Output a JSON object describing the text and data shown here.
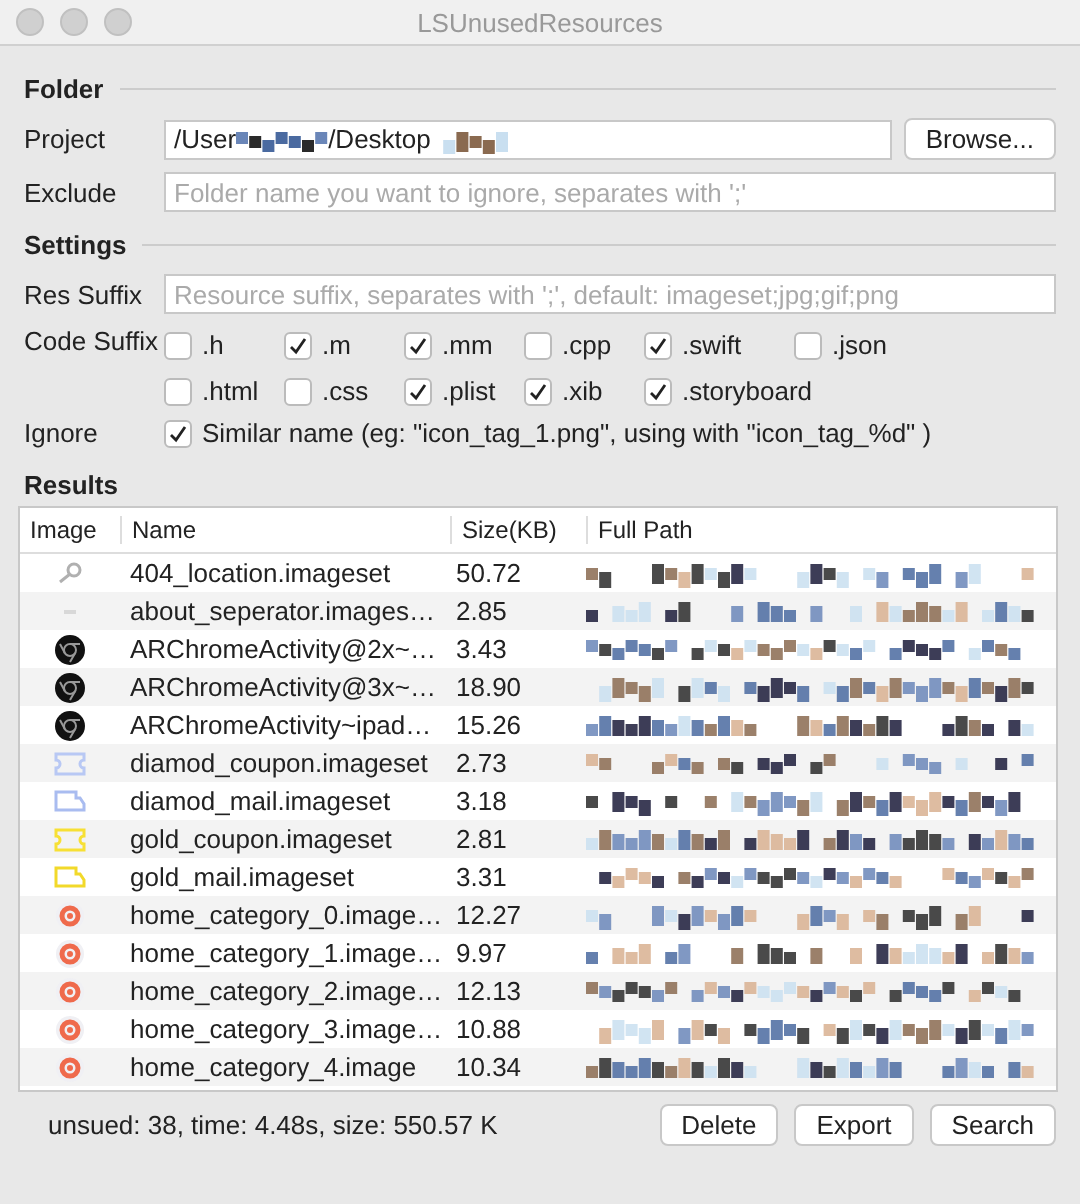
{
  "window": {
    "title": "LSUnusedResources"
  },
  "folder": {
    "heading": "Folder",
    "project_label": "Project",
    "project_parts": [
      "/User",
      "/Desktop"
    ],
    "browse_button": "Browse...",
    "exclude_label": "Exclude",
    "exclude_placeholder": "Folder name you want to ignore, separates with ';'"
  },
  "settings": {
    "heading": "Settings",
    "res_suffix_label": "Res Suffix",
    "res_suffix_placeholder": "Resource suffix, separates with ';', default: imageset;jpg;gif;png",
    "code_suffix_label": "Code Suffix",
    "suffixes": [
      [
        {
          "label": ".h",
          "checked": false
        },
        {
          "label": ".m",
          "checked": true
        },
        {
          "label": ".mm",
          "checked": true
        },
        {
          "label": ".cpp",
          "checked": false
        },
        {
          "label": ".swift",
          "checked": true
        },
        {
          "label": ".json",
          "checked": false
        }
      ],
      [
        {
          "label": ".html",
          "checked": false
        },
        {
          "label": ".css",
          "checked": false
        },
        {
          "label": ".plist",
          "checked": true
        },
        {
          "label": ".xib",
          "checked": true
        },
        {
          "label": ".storyboard",
          "checked": true
        }
      ]
    ],
    "ignore_label": "Ignore",
    "ignore_option": {
      "label": "Similar name (eg: \"icon_tag_1.png\", using with \"icon_tag_%d\" )",
      "checked": true
    }
  },
  "results": {
    "heading": "Results",
    "columns": [
      "Image",
      "Name",
      "Size(KB)",
      "Full Path"
    ],
    "rows": [
      {
        "kind": "pin",
        "color": "#b0b0b0",
        "name": "404_location.imageset",
        "size": "50.72"
      },
      {
        "kind": "line",
        "color": "#d8d8d8",
        "name": "about_seperator.images…",
        "size": "2.85"
      },
      {
        "kind": "chrome",
        "color": "#111111",
        "name": "ARChromeActivity@2x~…",
        "size": "3.43"
      },
      {
        "kind": "chrome",
        "color": "#111111",
        "name": "ARChromeActivity@3x~…",
        "size": "18.90"
      },
      {
        "kind": "chrome",
        "color": "#111111",
        "name": "ARChromeActivity~ipad…",
        "size": "15.26"
      },
      {
        "kind": "coupon",
        "color": "#b8c8f4",
        "name": "diamod_coupon.imageset",
        "size": "2.73"
      },
      {
        "kind": "mail",
        "color": "#a9bcf0",
        "name": "diamod_mail.imageset",
        "size": "3.18"
      },
      {
        "kind": "coupon",
        "color": "#f7e034",
        "name": "gold_coupon.imageset",
        "size": "2.81"
      },
      {
        "kind": "mail",
        "color": "#f2d92a",
        "name": "gold_mail.imageset",
        "size": "3.31"
      },
      {
        "kind": "category",
        "color": "#ef6a4c",
        "name": "home_category_0.image…",
        "size": "12.27"
      },
      {
        "kind": "category",
        "color": "#ef6a4c",
        "name": "home_category_1.image…",
        "size": "9.97"
      },
      {
        "kind": "category",
        "color": "#ef6a4c",
        "name": "home_category_2.image…",
        "size": "12.13"
      },
      {
        "kind": "category",
        "color": "#ef6a4c",
        "name": "home_category_3.image…",
        "size": "10.88"
      },
      {
        "kind": "category",
        "color": "#ef6a4c",
        "name": "home_category_4.image",
        "size": "10.34"
      }
    ]
  },
  "status": "unsued: 38, time: 4.48s, size: 550.57 K",
  "buttons": [
    "Delete",
    "Export",
    "Search"
  ]
}
